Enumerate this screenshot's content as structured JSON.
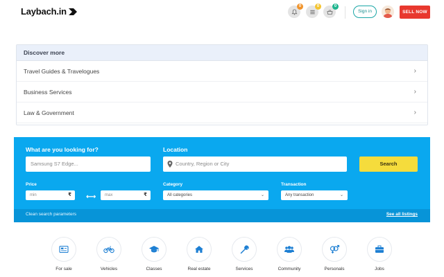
{
  "header": {
    "logo_text": "Laybach.in",
    "notifications_count": "0",
    "list_count": "0",
    "cart_count": "0",
    "signin_label": "Sign in",
    "sell_label": "SELL NOW",
    "badge_colors": {
      "notifications": "#f0932b",
      "list": "#f4c430",
      "cart": "#1fb58f"
    }
  },
  "discover": {
    "title": "Discover more",
    "items": [
      {
        "label": "Travel Guides & Travelogues"
      },
      {
        "label": "Business Services"
      },
      {
        "label": "Law & Government"
      }
    ]
  },
  "search": {
    "what_label": "What are you looking for?",
    "what_placeholder": "Samsung S7 Edge...",
    "location_label": "Location",
    "location_placeholder": "Country, Region or City",
    "search_button": "Search",
    "price_label": "Price",
    "price_min_placeholder": "min",
    "price_max_placeholder": "max",
    "currency_symbol": "₹",
    "range_separator": "⟷",
    "category_label": "Category",
    "category_value": "All categories",
    "transaction_label": "Transaction",
    "transaction_value": "Any transaction",
    "clean_label": "Clean search parameters",
    "see_all_label": "See all listings",
    "colors": {
      "panel": "#0aa8ef",
      "button": "#f5dc3c"
    }
  },
  "categories": [
    {
      "label": "For sale",
      "icon": "for-sale-icon"
    },
    {
      "label": "Vehicles",
      "icon": "motorbike-icon"
    },
    {
      "label": "Classes",
      "icon": "graduation-cap-icon"
    },
    {
      "label": "Real estate",
      "icon": "home-icon"
    },
    {
      "label": "Services",
      "icon": "wrench-icon"
    },
    {
      "label": "Community",
      "icon": "users-icon"
    },
    {
      "label": "Personals",
      "icon": "gender-icon"
    },
    {
      "label": "Jobs",
      "icon": "briefcase-icon"
    }
  ]
}
